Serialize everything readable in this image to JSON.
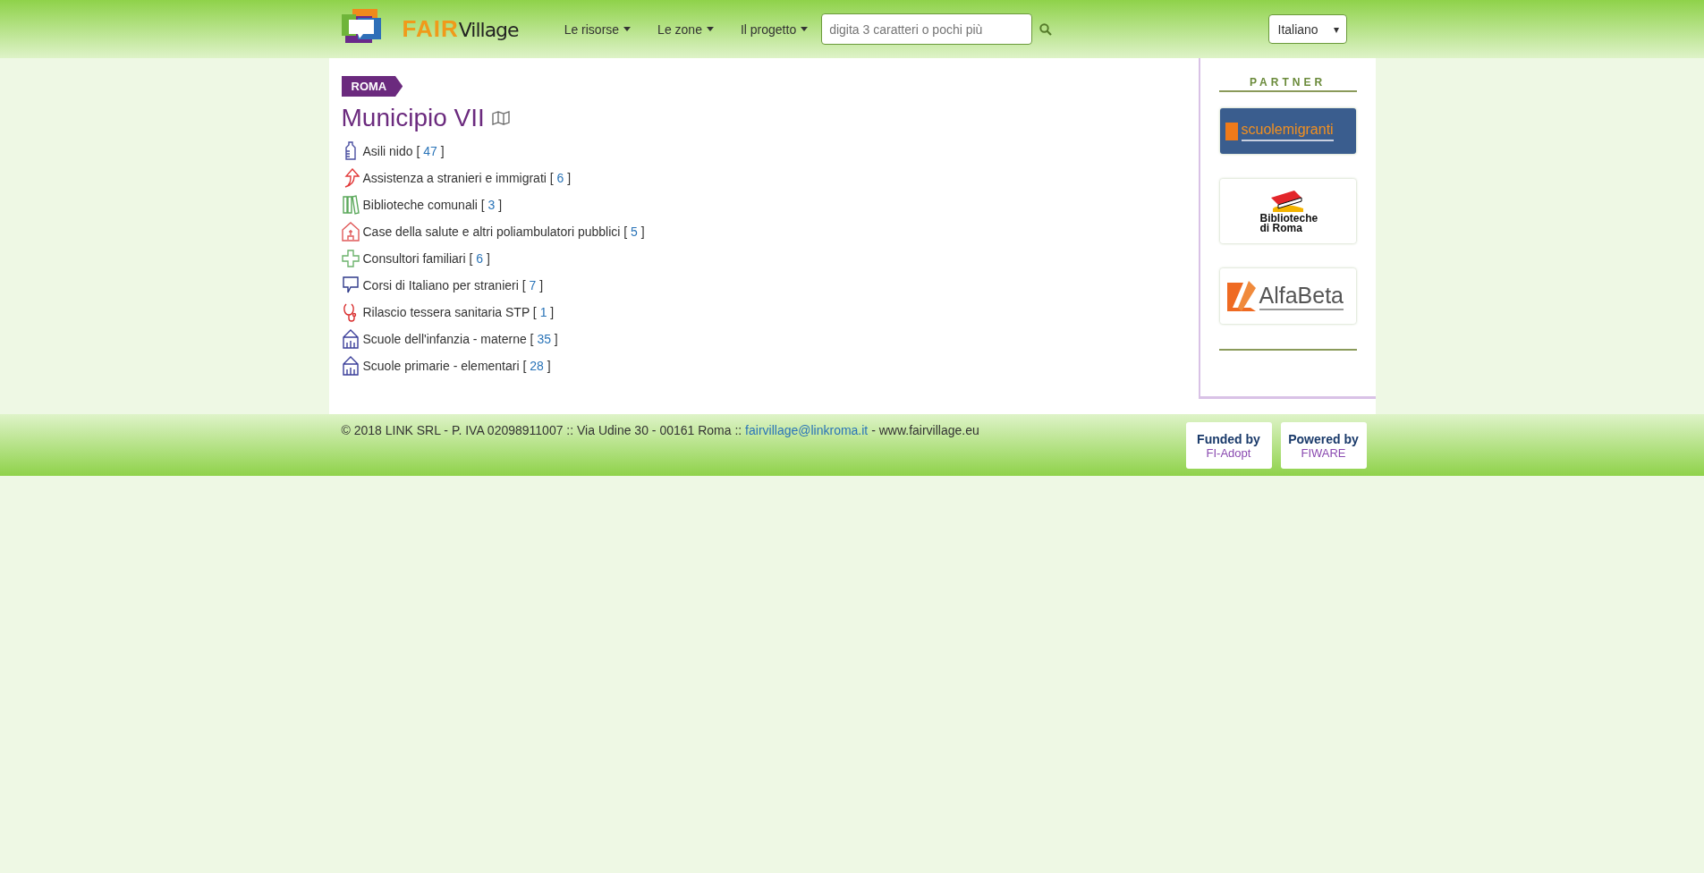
{
  "header": {
    "logo": {
      "part_1": "FAIR",
      "part_2": "Village"
    },
    "menu": [
      {
        "label": "Le risorse"
      },
      {
        "label": "Le zone"
      },
      {
        "label": "Il progetto"
      }
    ],
    "search": {
      "placeholder": "digita 3 caratteri o pochi più"
    },
    "language": {
      "value": "Italiano",
      "arrow": "▾"
    }
  },
  "breadcrumb": "ROMA",
  "title": "Municipio VII",
  "resources": [
    {
      "kind": "bottle",
      "label": "Asili nido [",
      "count": "47",
      "close": "]"
    },
    {
      "kind": "arrow",
      "label": "Assistenza a stranieri e immigrati [",
      "count": "6",
      "close": "]"
    },
    {
      "kind": "books",
      "label": "Biblioteche comunali [",
      "count": "3",
      "close": "]"
    },
    {
      "kind": "house",
      "label": "Case della salute e altri poliambulatori pubblici [",
      "count": "5",
      "close": "]"
    },
    {
      "kind": "cross",
      "label": "Consultori familiari [",
      "count": "6",
      "close": "]"
    },
    {
      "kind": "speech",
      "label": "Corsi di Italiano per stranieri [",
      "count": "7",
      "close": "]"
    },
    {
      "kind": "stethoscope",
      "label": "Rilascio tessera sanitaria STP [",
      "count": "1",
      "close": "]"
    },
    {
      "kind": "school",
      "label": "Scuole dell'infanzia - materne [",
      "count": "35",
      "close": "]"
    },
    {
      "kind": "school",
      "label": "Scuole primarie - elementari [",
      "count": "28",
      "close": "]"
    }
  ],
  "sidebar": {
    "heading": "PARTNER",
    "partners": [
      {
        "kind": "scuolemigranti",
        "name": "scuolemigranti"
      },
      {
        "kind": "biblioteche",
        "name": "Biblioteche di Roma"
      },
      {
        "kind": "alfabeta",
        "name": "AlfaBeta"
      }
    ]
  },
  "footer": {
    "text_before": "© 2018 LINK SRL - P. IVA 02098911007 :: Via Udine 30 - 00161 Roma ::",
    "email": "fairvillage@linkroma.it",
    "text_after": "- www.fairvillage.eu",
    "badges": [
      {
        "caption": "Funded by",
        "brand": "FI-Adopt"
      },
      {
        "caption": "Powered by",
        "brand": "FIWARE"
      }
    ]
  }
}
